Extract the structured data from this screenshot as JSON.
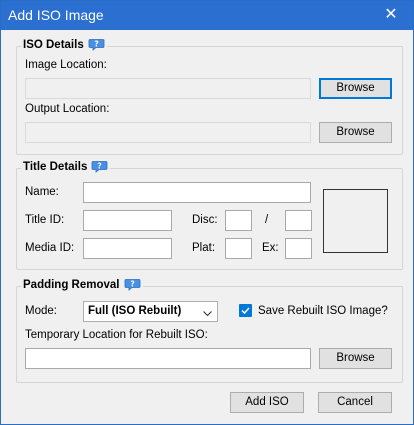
{
  "window": {
    "title": "Add ISO Image",
    "close_glyph": "✕"
  },
  "iso_details": {
    "title": "ISO Details",
    "image_location_label": "Image Location:",
    "image_location_value": "",
    "output_location_label": "Output Location:",
    "output_location_value": "",
    "browse_image_label": "Browse",
    "browse_output_label": "Browse"
  },
  "title_details": {
    "title": "Title Details",
    "name_label": "Name:",
    "name_value": "",
    "title_id_label": "Title ID:",
    "title_id_value": "",
    "disc_label": "Disc:",
    "disc_value": "",
    "disc_separator": "/",
    "disc_total_value": "",
    "media_id_label": "Media ID:",
    "media_id_value": "",
    "plat_label": "Plat:",
    "plat_value": "",
    "ex_label": "Ex:",
    "ex_value": ""
  },
  "padding_removal": {
    "title": "Padding Removal",
    "mode_label": "Mode:",
    "mode_selected": "Full (ISO Rebuilt)",
    "save_rebuilt_label": "Save Rebuilt ISO Image?",
    "save_rebuilt_checked": true,
    "temp_location_label": "Temporary Location for Rebuilt ISO:",
    "temp_location_value": "",
    "browse_temp_label": "Browse"
  },
  "footer": {
    "add_iso_label": "Add ISO",
    "cancel_label": "Cancel"
  },
  "icons": {
    "help": "help-icon",
    "close": "close-icon",
    "chevron": "chevron-down-icon",
    "check": "check-icon"
  },
  "colors": {
    "titlebar": "#2b6fd1",
    "accent": "#0078d7",
    "window_bg": "#f0f0f0"
  }
}
